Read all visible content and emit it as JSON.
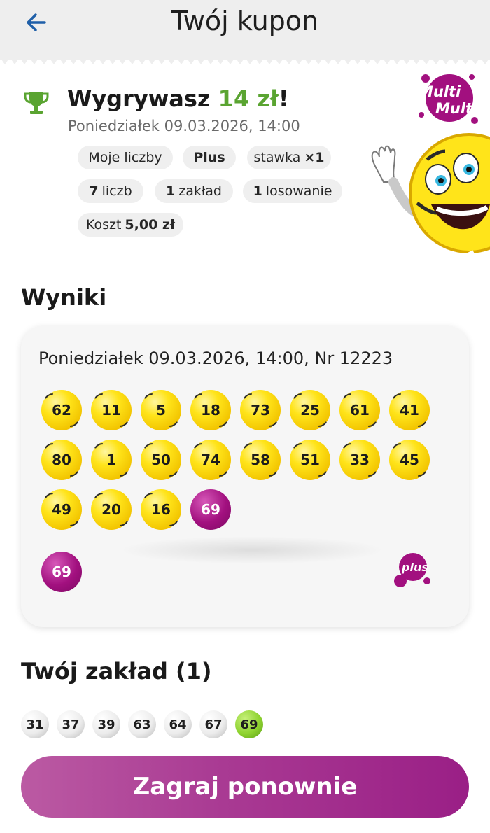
{
  "header": {
    "title": "Twój kupon",
    "back_icon": "arrow-left-icon"
  },
  "win": {
    "prefix": "Wygrywasz",
    "amount": "14 zł",
    "suffix": "!",
    "date": "Poniedziałek 09.03.2026, 14:00"
  },
  "chips": {
    "my_numbers": "Moje liczby",
    "plus": "Plus",
    "stake_label": "stawka",
    "stake_value": "×1",
    "numbers_count": "7",
    "numbers_label": "liczb",
    "bets_count": "1",
    "bets_label": "zakład",
    "draws_count": "1",
    "draws_label": "losowanie",
    "cost_label": "Koszt",
    "cost_value": "5,00 zł"
  },
  "logo": {
    "line1": "Multi",
    "line2": "Multi"
  },
  "results": {
    "title": "Wyniki",
    "draw": "Poniedziałek 09.03.2026, 14:00, Nr 12223",
    "balls": [
      "62",
      "11",
      "5",
      "18",
      "73",
      "25",
      "61",
      "41",
      "80",
      "1",
      "50",
      "74",
      "58",
      "51",
      "33",
      "45",
      "49",
      "20",
      "16",
      "69"
    ],
    "purple_ball": "69",
    "plus_ball": "69",
    "plus_logo": "plus"
  },
  "bet": {
    "title": "Twój zakład (1)",
    "numbers": [
      "31",
      "37",
      "39",
      "63",
      "64",
      "67",
      "69"
    ],
    "highlight_color": "#8ed32f"
  },
  "cta": {
    "label": "Zagraj ponownie"
  },
  "colors": {
    "win_green": "#5aa431",
    "brand_purple": "#a2107f",
    "ball_yellow": "#ffe41a"
  }
}
